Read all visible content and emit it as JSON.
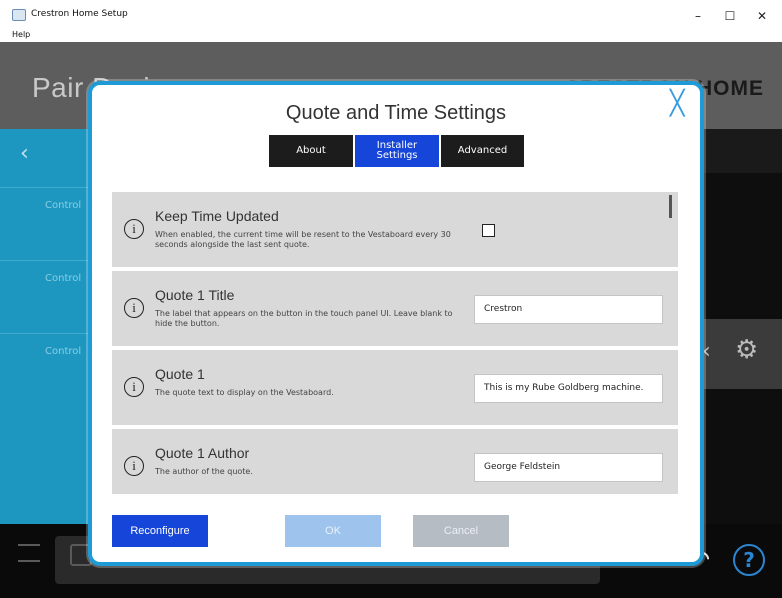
{
  "window": {
    "title": "Crestron Home Setup",
    "minimize": "–",
    "maximize": "☐",
    "close": "✕"
  },
  "menu": {
    "help": "Help"
  },
  "background": {
    "page_title": "Pair Devices",
    "brand": "CRESTRON HOME",
    "back": "‹",
    "rows": [
      "Control",
      "Control",
      "Control"
    ],
    "chevron": "‹",
    "gear": "⚙",
    "undo": "↶",
    "help": "?"
  },
  "modal": {
    "title": "Quote and Time Settings",
    "close": "╳",
    "tabs": [
      {
        "label": "About",
        "active": false
      },
      {
        "label": "Installer\nSettings",
        "active": true
      },
      {
        "label": "Advanced",
        "active": false
      }
    ],
    "settings": [
      {
        "info": "i",
        "title": "Keep Time Updated",
        "description": "When enabled, the current time will be resent to the Vestaboard every 30 seconds alongside the last sent quote.",
        "type": "checkbox",
        "checked": false
      },
      {
        "info": "i",
        "title": "Quote 1 Title",
        "description": "The label that appears on the button in the touch panel UI. Leave blank to hide the button.",
        "type": "text",
        "value": "Crestron"
      },
      {
        "info": "i",
        "title": "Quote 1",
        "description": "The quote text to display on the Vestaboard.",
        "type": "text",
        "value": "This is my Rube Goldberg machine."
      },
      {
        "info": "i",
        "title": "Quote 1 Author",
        "description": "The author of the quote.",
        "type": "text",
        "value": "George Feldstein"
      }
    ],
    "buttons": {
      "reconfigure": "Reconfigure",
      "ok": "OK",
      "cancel": "Cancel"
    }
  },
  "colors": {
    "accent": "#1646d9",
    "modal_border": "#1e9bd6",
    "sidebar": "#1d97c0"
  }
}
